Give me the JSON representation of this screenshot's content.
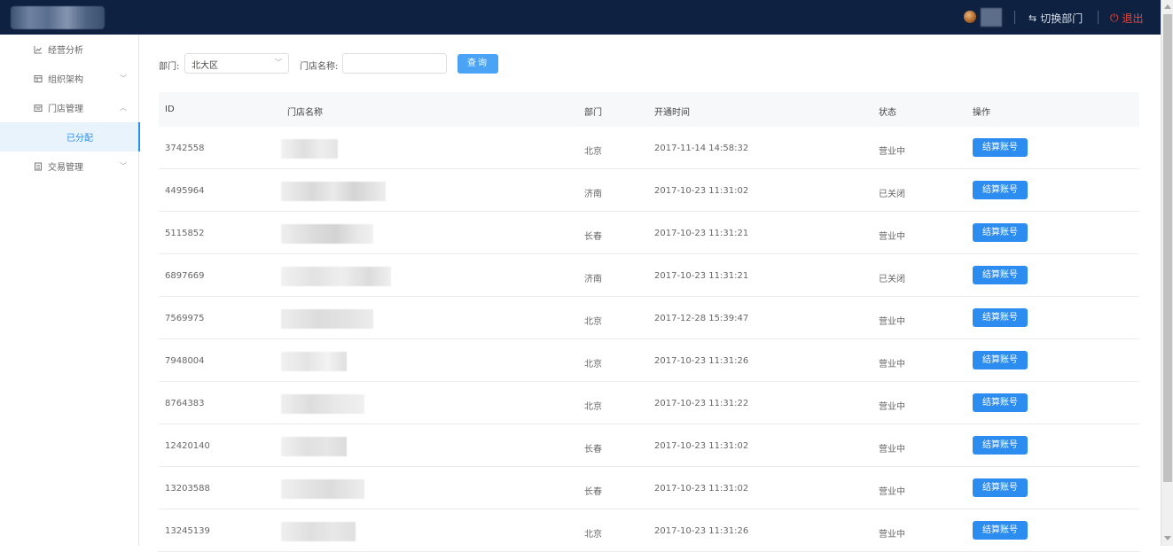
{
  "header": {
    "switch_label": "切换部门",
    "logout_label": "退出"
  },
  "sidebar": {
    "items": [
      {
        "label": "经营分析",
        "icon": "chart-line-icon"
      },
      {
        "label": "组织架构",
        "icon": "org-icon"
      },
      {
        "label": "门店管理",
        "icon": "store-icon"
      },
      {
        "label": "已分配"
      },
      {
        "label": "交易管理",
        "icon": "list-icon"
      }
    ]
  },
  "filters": {
    "dept_label": "部门:",
    "dept_value": "北大区",
    "store_name_label": "门店名称:",
    "store_name_value": "",
    "query_label": "查询"
  },
  "table": {
    "headers": [
      "ID",
      "门店名称",
      "部门",
      "开通时间",
      "状态",
      "操作"
    ],
    "action_label": "结算账号",
    "rows": [
      {
        "id": "3742558",
        "dept": "北京",
        "time": "2017-11-14 14:58:32",
        "status": "营业中"
      },
      {
        "id": "4495964",
        "dept": "济南",
        "time": "2017-10-23 11:31:02",
        "status": "已关闭"
      },
      {
        "id": "5115852",
        "dept": "长春",
        "time": "2017-10-23 11:31:21",
        "status": "营业中"
      },
      {
        "id": "6897669",
        "dept": "济南",
        "time": "2017-10-23 11:31:21",
        "status": "已关闭"
      },
      {
        "id": "7569975",
        "dept": "北京",
        "time": "2017-12-28 15:39:47",
        "status": "营业中"
      },
      {
        "id": "7948004",
        "dept": "北京",
        "time": "2017-10-23 11:31:26",
        "status": "营业中"
      },
      {
        "id": "8764383",
        "dept": "北京",
        "time": "2017-10-23 11:31:22",
        "status": "营业中"
      },
      {
        "id": "12420140",
        "dept": "长春",
        "time": "2017-10-23 11:31:02",
        "status": "营业中"
      },
      {
        "id": "13203588",
        "dept": "长春",
        "time": "2017-10-23 11:31:02",
        "status": "营业中"
      },
      {
        "id": "13245139",
        "dept": "北京",
        "time": "2017-10-23 11:31:26",
        "status": "营业中"
      }
    ]
  },
  "colors": {
    "header_bg": "#0f2140",
    "accent": "#2d8cf0",
    "logout": "#e8473c"
  }
}
